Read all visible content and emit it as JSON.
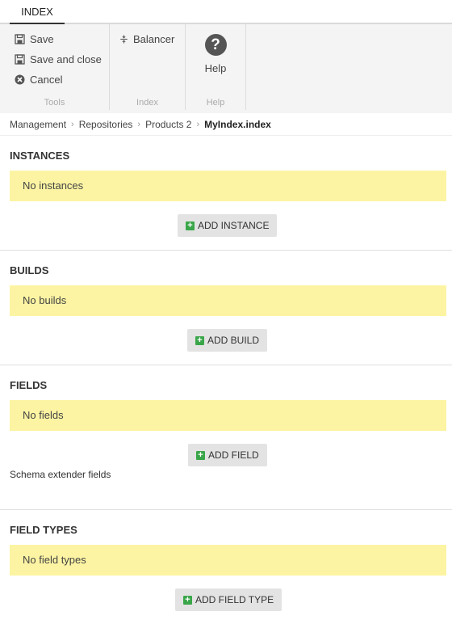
{
  "tab": {
    "label": "INDEX"
  },
  "ribbon": {
    "tools": {
      "label": "Tools",
      "save": "Save",
      "save_close": "Save and close",
      "cancel": "Cancel"
    },
    "index": {
      "label": "Index",
      "balancer": "Balancer"
    },
    "help": {
      "label": "Help",
      "button": "Help"
    }
  },
  "breadcrumb": [
    "Management",
    "Repositories",
    "Products 2",
    "MyIndex.index"
  ],
  "sections": {
    "instances": {
      "title": "INSTANCES",
      "empty": "No instances",
      "add": "ADD INSTANCE"
    },
    "builds": {
      "title": "BUILDS",
      "empty": "No builds",
      "add": "ADD BUILD"
    },
    "fields": {
      "title": "FIELDS",
      "empty": "No fields",
      "add": "ADD FIELD",
      "extra": "Schema extender fields"
    },
    "field_types": {
      "title": "FIELD TYPES",
      "empty": "No field types",
      "add": "ADD FIELD TYPE"
    }
  },
  "colors": {
    "empty_bg": "#fcf4a3",
    "add_icon": "#3aa64a",
    "button_bg": "#e3e3e3"
  },
  "icons": {
    "save": "save-icon",
    "save_close": "save-close-icon",
    "cancel": "cancel-icon",
    "balancer": "balancer-icon",
    "help": "help-icon",
    "add": "plus-icon"
  }
}
